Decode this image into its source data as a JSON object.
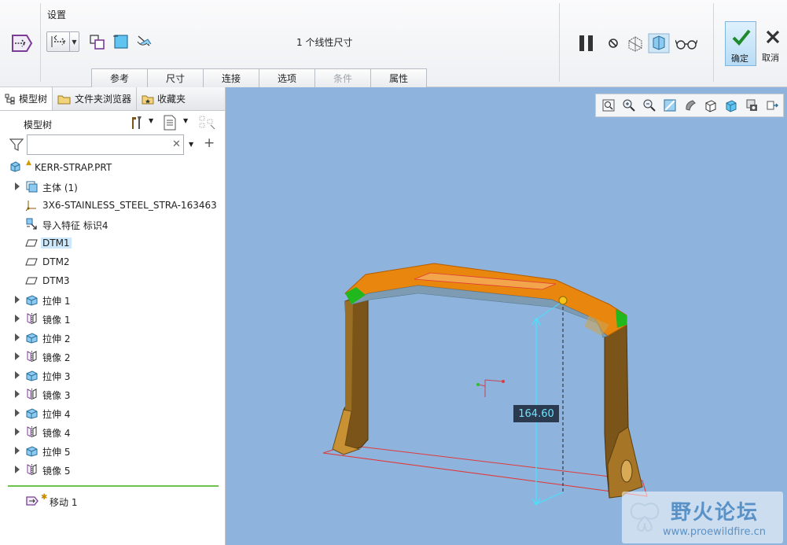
{
  "ribbon": {
    "settings_label": "设置",
    "status_text": "1 个线性尺寸",
    "tabs": [
      {
        "label": "参考",
        "enabled": true
      },
      {
        "label": "尺寸",
        "enabled": true
      },
      {
        "label": "连接",
        "enabled": true
      },
      {
        "label": "选项",
        "enabled": true
      },
      {
        "label": "条件",
        "enabled": false
      },
      {
        "label": "属性",
        "enabled": true
      }
    ],
    "confirm_label": "确定",
    "cancel_label": "取消"
  },
  "left_panel": {
    "tabs": [
      "模型树",
      "文件夹浏览器",
      "收藏夹"
    ],
    "tree_title": "模型树",
    "filter_placeholder": "",
    "tree": [
      {
        "label": "KERR-STRAP.PRT",
        "icon": "part-icon",
        "expandable": false,
        "root": true
      },
      {
        "label": "主体 (1)",
        "icon": "body-icon",
        "expandable": true
      },
      {
        "label": "3X6-STAINLESS_STEEL_STRA-163463",
        "icon": "csys-icon",
        "expandable": false
      },
      {
        "label": "导入特征 标识4",
        "icon": "import-feature-icon",
        "expandable": false
      },
      {
        "label": "DTM1",
        "icon": "datum-plane-icon",
        "expandable": false,
        "selected": true
      },
      {
        "label": "DTM2",
        "icon": "datum-plane-icon",
        "expandable": false
      },
      {
        "label": "DTM3",
        "icon": "datum-plane-icon",
        "expandable": false
      },
      {
        "label": "拉伸 1",
        "icon": "extrude-icon",
        "expandable": true
      },
      {
        "label": "镜像 1",
        "icon": "mirror-icon",
        "expandable": true
      },
      {
        "label": "拉伸 2",
        "icon": "extrude-icon",
        "expandable": true
      },
      {
        "label": "镜像 2",
        "icon": "mirror-icon",
        "expandable": true
      },
      {
        "label": "拉伸 3",
        "icon": "extrude-icon",
        "expandable": true
      },
      {
        "label": "镜像 3",
        "icon": "mirror-icon",
        "expandable": true
      },
      {
        "label": "拉伸 4",
        "icon": "extrude-icon",
        "expandable": true
      },
      {
        "label": "镜像 4",
        "icon": "mirror-icon",
        "expandable": true
      },
      {
        "label": "拉伸 5",
        "icon": "extrude-icon",
        "expandable": true
      },
      {
        "label": "镜像 5",
        "icon": "mirror-icon",
        "expandable": true
      }
    ],
    "active_feature": "移动 1"
  },
  "viewport": {
    "dimension_value": "164.60",
    "watermark_title": "野火论坛",
    "watermark_url": "www.proewildfire.cn",
    "colors": {
      "background": "#8eb3dc",
      "part": "#e8860d",
      "leg": "#7a5418",
      "edge_highlight": "#21b81e",
      "sketch_line": "#e03a3a",
      "dimension": "#46e2ff"
    }
  }
}
